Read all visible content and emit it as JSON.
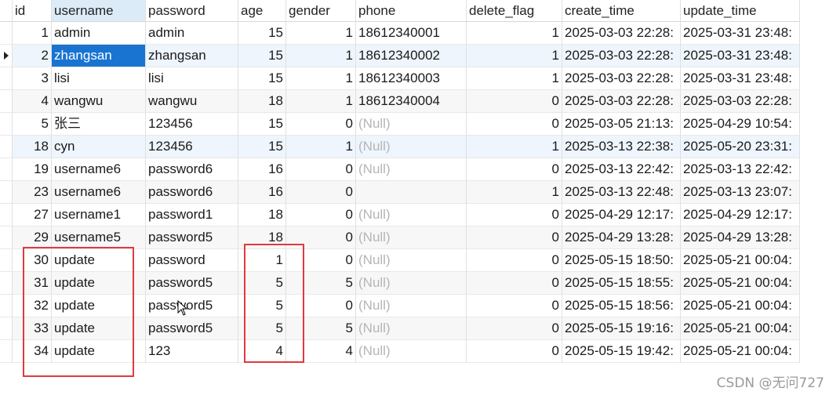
{
  "columns": [
    "id",
    "username",
    "password",
    "age",
    "gender",
    "phone",
    "delete_flag",
    "create_time",
    "update_time"
  ],
  "rows": [
    {
      "id": "1",
      "username": "admin",
      "password": "admin",
      "age": "15",
      "gender": "1",
      "phone": "18612340001",
      "delete_flag": "1",
      "create_time": "2025-03-03 22:28:",
      "update_time": "2025-03-31 23:48:"
    },
    {
      "id": "2",
      "username": "zhangsan",
      "password": "zhangsan",
      "age": "15",
      "gender": "1",
      "phone": "18612340002",
      "delete_flag": "1",
      "create_time": "2025-03-03 22:28:",
      "update_time": "2025-03-31 23:48:"
    },
    {
      "id": "3",
      "username": "lisi",
      "password": "lisi",
      "age": "15",
      "gender": "1",
      "phone": "18612340003",
      "delete_flag": "1",
      "create_time": "2025-03-03 22:28:",
      "update_time": "2025-03-31 23:48:"
    },
    {
      "id": "4",
      "username": "wangwu",
      "password": "wangwu",
      "age": "18",
      "gender": "1",
      "phone": "18612340004",
      "delete_flag": "0",
      "create_time": "2025-03-03 22:28:",
      "update_time": "2025-03-03 22:28:"
    },
    {
      "id": "5",
      "username": "张三",
      "password": "123456",
      "age": "15",
      "gender": "0",
      "phone": "(Null)",
      "delete_flag": "0",
      "create_time": "2025-03-05 21:13:",
      "update_time": "2025-04-29 10:54:"
    },
    {
      "id": "18",
      "username": "cyn",
      "password": "123456",
      "age": "15",
      "gender": "1",
      "phone": "(Null)",
      "delete_flag": "1",
      "create_time": "2025-03-13 22:38:",
      "update_time": "2025-05-20 23:31:"
    },
    {
      "id": "19",
      "username": "username6",
      "password": "password6",
      "age": "16",
      "gender": "0",
      "phone": "(Null)",
      "delete_flag": "0",
      "create_time": "2025-03-13 22:42:",
      "update_time": "2025-03-13 22:42:"
    },
    {
      "id": "23",
      "username": "username6",
      "password": "password6",
      "age": "16",
      "gender": "0",
      "phone": "",
      "delete_flag": "1",
      "create_time": "2025-03-13 22:48:",
      "update_time": "2025-03-13 23:07:"
    },
    {
      "id": "27",
      "username": "username1",
      "password": "password1",
      "age": "18",
      "gender": "0",
      "phone": "(Null)",
      "delete_flag": "0",
      "create_time": "2025-04-29 12:17:",
      "update_time": "2025-04-29 12:17:"
    },
    {
      "id": "29",
      "username": "username5",
      "password": "password5",
      "age": "18",
      "gender": "0",
      "phone": "(Null)",
      "delete_flag": "0",
      "create_time": "2025-04-29 13:28:",
      "update_time": "2025-04-29 13:28:"
    },
    {
      "id": "30",
      "username": "update",
      "password": "password",
      "age": "1",
      "gender": "0",
      "phone": "(Null)",
      "delete_flag": "0",
      "create_time": "2025-05-15 18:50:",
      "update_time": "2025-05-21 00:04:"
    },
    {
      "id": "31",
      "username": "update",
      "password": "password5",
      "age": "5",
      "gender": "5",
      "phone": "(Null)",
      "delete_flag": "0",
      "create_time": "2025-05-15 18:55:",
      "update_time": "2025-05-21 00:04:"
    },
    {
      "id": "32",
      "username": "update",
      "password": "password5",
      "age": "5",
      "gender": "0",
      "phone": "(Null)",
      "delete_flag": "0",
      "create_time": "2025-05-15 18:56:",
      "update_time": "2025-05-21 00:04:"
    },
    {
      "id": "33",
      "username": "update",
      "password": "password5",
      "age": "5",
      "gender": "5",
      "phone": "(Null)",
      "delete_flag": "0",
      "create_time": "2025-05-15 19:16:",
      "update_time": "2025-05-21 00:04:"
    },
    {
      "id": "34",
      "username": "update",
      "password": "123",
      "age": "4",
      "gender": "4",
      "phone": "(Null)",
      "delete_flag": "0",
      "create_time": "2025-05-15 19:42:",
      "update_time": "2025-05-21 00:04:"
    }
  ],
  "selected_row_index": 1,
  "selected_column": "username",
  "colors": {
    "selection": "#1874d0",
    "null_text": "#b5b5b5",
    "annotation": "#e0393e"
  },
  "watermark": "CSDN @无问727"
}
